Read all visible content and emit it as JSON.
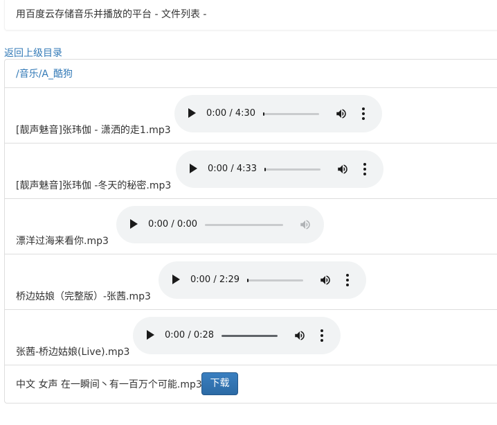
{
  "header": {
    "title": "用百度云存储音乐并播放的平台 - 文件列表 -"
  },
  "nav": {
    "back_label": "返回上级目录"
  },
  "path": {
    "label": "/音乐/A_酷狗"
  },
  "files": [
    {
      "name": "[靓声魅音]张玮伽 - 潇洒的走1.mp3",
      "time": "0:00 / 4:30",
      "progress": 0,
      "volume_enabled": true
    },
    {
      "name": "[靓声魅音]张玮伽 -冬天的秘密.mp3",
      "time": "0:00 / 4:33",
      "progress": 0,
      "volume_enabled": true
    },
    {
      "name": "漂洋过海来看你.mp3",
      "time": "0:00 / 0:00",
      "progress": 0,
      "volume_enabled": false
    },
    {
      "name": "桥边姑娘（完整版）-张茜.mp3",
      "time": "0:00 / 2:29",
      "progress": 0,
      "volume_enabled": true
    },
    {
      "name": "张茜-桥边姑娘(Live).mp3",
      "time": "0:00 / 0:28",
      "progress": 0,
      "volume_enabled": true
    }
  ],
  "download_item": {
    "name": "中文 女声 在一瞬间丶有一百万个可能.mp3",
    "button_label": "下载"
  },
  "icons": {
    "play": "play-icon",
    "volume": "volume-icon",
    "menu": "more-vert-icon"
  },
  "colors": {
    "link": "#337ab7",
    "button": "#2c6aa5",
    "player_bg": "#f1f3f4"
  }
}
